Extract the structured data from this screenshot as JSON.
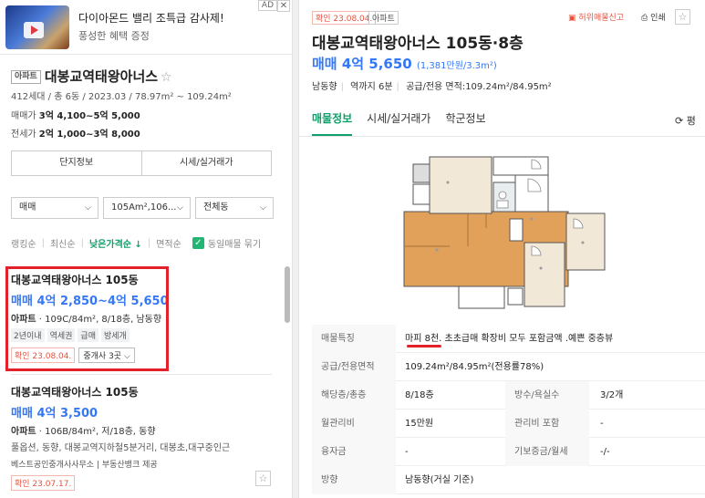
{
  "ad": {
    "title": "다이아몬드 밸리 조특급 감사제!",
    "subtitle": "풍성한 혜택 증정",
    "badge": "AD",
    "close": "✕"
  },
  "complex": {
    "type": "아파트",
    "name": "대봉교역태왕아너스",
    "meta": "412세대 / 총 6동 / 2023.03 / 78.97m² ~ 109.24m²",
    "sale_label": "매매가",
    "sale_value": "3억 4,100~5억 5,000",
    "jeonse_label": "전세가",
    "jeonse_value": "2억 1,000~3억 8,000",
    "btn_info": "단지정보",
    "btn_price": "시세/실거래가"
  },
  "filters": {
    "trade": "매매",
    "area": "105Am²,106...",
    "dong": "전체동"
  },
  "sort": {
    "ranking": "랭킹순",
    "latest": "최신순",
    "low_price": "낮은가격순 ↓",
    "area": "면적순",
    "group_label": "동일매물 묶기"
  },
  "listings": [
    {
      "name": "대봉교역태왕아너스 105동",
      "price": "매매 4억 2,850~4억 5,650",
      "desc_type": "아파트",
      "desc": "109C/84m², 8/18층, 남동향",
      "tags": [
        "2년이내",
        "역세권",
        "급매",
        "방세개"
      ],
      "confirm": "확인 23.08.04.",
      "agent_btn": "중개사 3곳 ⌵"
    },
    {
      "name": "대봉교역태왕아너스 105동",
      "price": "매매 4억 3,500",
      "desc_type": "아파트",
      "desc": "106B/84m², 저/18층, 동향",
      "desc2": "풀옵션, 동향, 대봉교역지하철5분거리, 대봉초,대구중인근",
      "agent": "베스트공인중개사사무소 | 부동산뱅크 제공",
      "confirm": "확인 23.07.17."
    }
  ],
  "detail": {
    "confirm": "확인 23.08.04.",
    "type": "아파트",
    "report": "허위매물신고",
    "print": "인쇄",
    "title": "대봉교역태왕아너스 105동·8층",
    "price": "매매 4억 5,650",
    "price_unit": "(1,381만원/3.3m²)",
    "direction": "남동향",
    "station": "역까지 6분",
    "area": "공급/전용 면적:109.24m²/84.95m²",
    "tabs": [
      "매물정보",
      "시세/실거래가",
      "학군정보"
    ],
    "refresh": "⟳ 평",
    "rows": [
      {
        "label": "매물특징",
        "value": "마피 8천. 초초급매 확장비 모두 포함금액 .예쁜 중층뷰"
      },
      {
        "label": "공급/전용면적",
        "value": "109.24m²/84.95m²(전용률78%)"
      },
      {
        "label": "해당층/총층",
        "value": "8/18층",
        "label2": "방수/욕실수",
        "value2": "3/2개"
      },
      {
        "label": "월관리비",
        "value": "15만원",
        "label2": "관리비 포함",
        "value2": "-"
      },
      {
        "label": "융자금",
        "value": "-",
        "label2": "기보증금/월세",
        "value2": "-/-"
      },
      {
        "label": "방향",
        "value": "남동향(거실 기준)"
      }
    ]
  },
  "colors": {
    "accent_green": "#0ea06a",
    "price_blue": "#3478f6",
    "confirm_red": "#e6523e",
    "highlight_red": "#e4202a"
  }
}
